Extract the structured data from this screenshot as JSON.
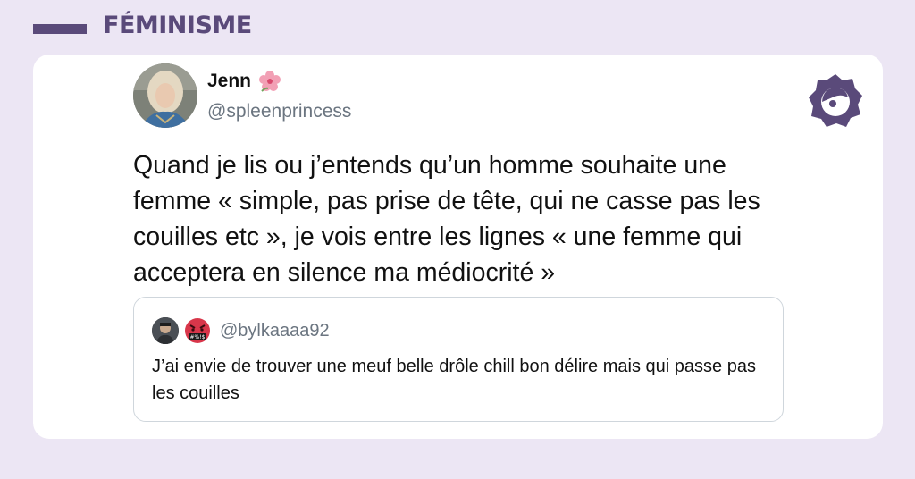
{
  "category": {
    "label": "FÉMINISME"
  },
  "tweet": {
    "author_name": "Jenn",
    "author_emoji_icon": "hibiscus-flower-icon",
    "author_handle": "@spleenprincess",
    "text": "Quand je lis ou j’entends qu’un homme souhaite une femme « simple, pas prise de tête, qui ne casse pas les couilles etc », je vois entre les lignes « une femme qui acceptera en silence ma médiocrité »"
  },
  "quoted_tweet": {
    "author_handle": "@bylkaaaa92",
    "text": "J’ai envie de trouver une meuf belle drôle chill bon délire mais qui passe pas les couilles"
  },
  "colors": {
    "background": "#ECE6F4",
    "brand_purple": "#5A4A7A",
    "handle_gray": "#6B7580"
  }
}
